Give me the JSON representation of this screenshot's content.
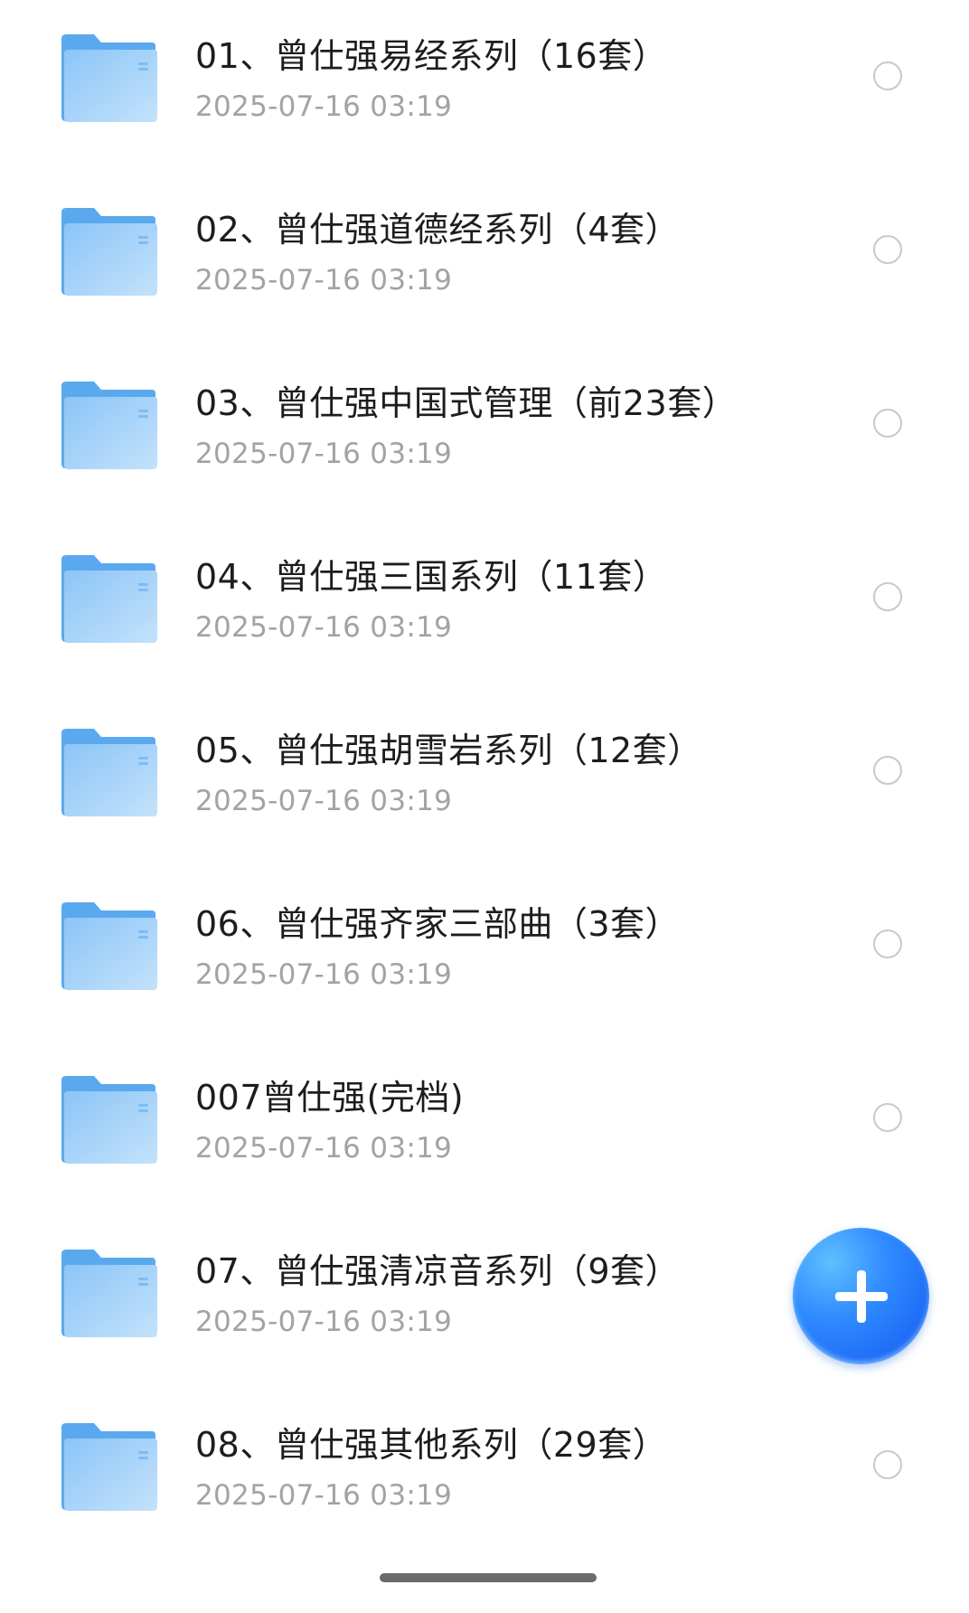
{
  "files": [
    {
      "name": "01、曾仕强易经系列（16套）",
      "date": "2025-07-16 03:19"
    },
    {
      "name": "02、曾仕强道德经系列（4套）",
      "date": "2025-07-16 03:19"
    },
    {
      "name": "03、曾仕强中国式管理（前23套）",
      "date": "2025-07-16 03:19"
    },
    {
      "name": "04、曾仕强三国系列（11套）",
      "date": "2025-07-16 03:19"
    },
    {
      "name": "05、曾仕强胡雪岩系列（12套）",
      "date": "2025-07-16 03:19"
    },
    {
      "name": "06、曾仕强齐家三部曲（3套）",
      "date": "2025-07-16 03:19"
    },
    {
      "name": "007曾仕强(完档)",
      "date": "2025-07-16 03:19"
    },
    {
      "name": "07、曾仕强清凉音系列（9套）",
      "date": "2025-07-16 03:19"
    },
    {
      "name": "08、曾仕强其他系列（29套）",
      "date": "2025-07-16 03:19"
    }
  ],
  "icons": {
    "folder": "folder-icon",
    "select": "radio-circle-icon",
    "fab": "plus-icon"
  },
  "colors": {
    "folder_back": "#5aa9ef",
    "folder_front": "#9fd0f8",
    "fab": "#2f7bff",
    "date_text": "#a3a3a3"
  }
}
